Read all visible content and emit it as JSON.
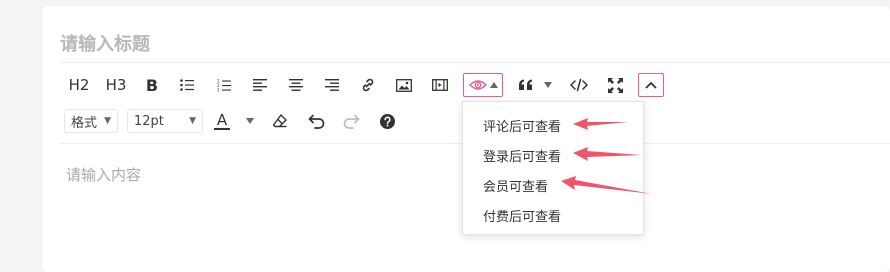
{
  "editor": {
    "title_placeholder": "请输入标题",
    "content_placeholder": "请输入内容"
  },
  "toolbar": {
    "h2_label": "H2",
    "h3_label": "H3",
    "bold_label": "B",
    "format_select_value": "格式",
    "font_size_value": "12pt",
    "font_color_label": "A",
    "accent_color": "#e75a9b"
  },
  "visibility_menu": {
    "items": [
      {
        "label": "评论后可查看"
      },
      {
        "label": "登录后可查看"
      },
      {
        "label": "会员可查看"
      },
      {
        "label": "付费后可查看"
      }
    ],
    "annotation_arrow_color": "#f0546a"
  }
}
